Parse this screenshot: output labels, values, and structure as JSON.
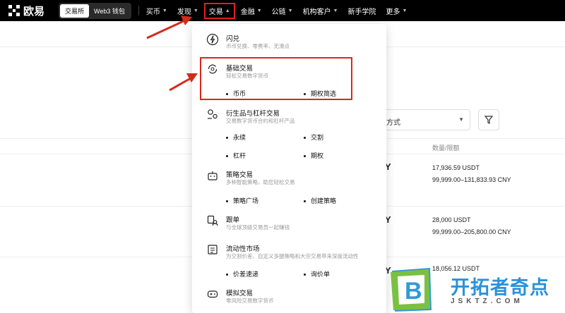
{
  "brand": {
    "name": "欧易"
  },
  "mode_switch": {
    "exchange": "交易所",
    "web3": "Web3 钱包"
  },
  "nav": [
    {
      "label": "买币"
    },
    {
      "label": "发现"
    },
    {
      "label": "交易"
    },
    {
      "label": "金融"
    },
    {
      "label": "公链"
    },
    {
      "label": "机构客户"
    },
    {
      "label": "新手学院"
    },
    {
      "label": "更多"
    }
  ],
  "menu": {
    "flash": {
      "title": "闪兑",
      "desc": "币币兑换、零费率、无滑点"
    },
    "basic": {
      "title": "基础交易",
      "desc": "轻松交易数字货币",
      "items": [
        "币币",
        "期权简选"
      ]
    },
    "derivatives": {
      "title": "衍生品与杠杆交易",
      "desc": "交易数字货币合约和杠杆产品",
      "items": [
        "永续",
        "交割",
        "杠杆",
        "期权"
      ]
    },
    "strategy": {
      "title": "策略交易",
      "desc": "多种智能策略，助您轻松交易",
      "items": [
        "策略广场",
        "创建策略"
      ]
    },
    "copy": {
      "title": "跟单",
      "desc": "与全球顶级交易员一起赚钱"
    },
    "liquidity": {
      "title": "流动性市场",
      "desc": "为交割价差、自定义多腿策略和大宗交易带来深度流动性",
      "items": [
        "价差速递",
        "询价单"
      ]
    },
    "demo": {
      "title": "模拟交易",
      "desc": "零风险交易数字货币"
    }
  },
  "table": {
    "method_label": "方式",
    "column_header": "数量/限额",
    "rows": [
      {
        "ccy": "Y",
        "amount": "17,936.59 USDT",
        "limit": "99,999.00–131,833.93 CNY"
      },
      {
        "ccy": "Y",
        "amount": "28,000 USDT",
        "limit": "99,999.00–205,800.00 CNY"
      },
      {
        "ccy": "Y",
        "amount": "18,056.12 USDT",
        "limit": ""
      }
    ]
  },
  "watermark": {
    "title": "开拓者奇点",
    "domain": "JSKTZ.COM",
    "badge_letter": "B"
  },
  "colors": {
    "highlight_red": "#d42a1a",
    "watermark_blue": "#2a92d8",
    "navbar": "#000000"
  }
}
